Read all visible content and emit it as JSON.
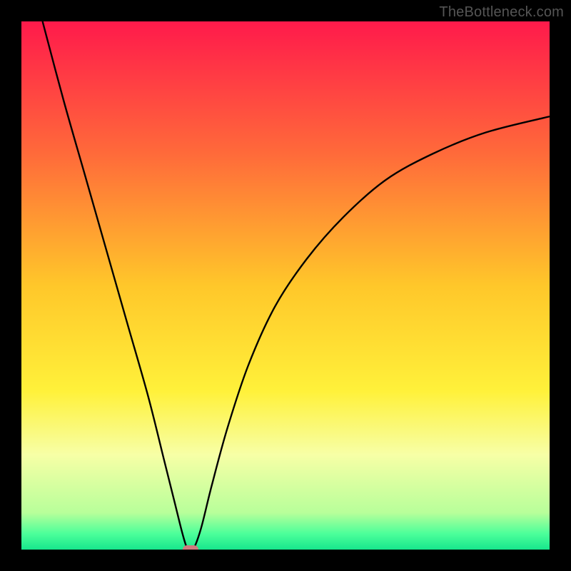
{
  "watermark": "TheBottleneck.com",
  "chart_data": {
    "type": "line",
    "title": "",
    "xlabel": "",
    "ylabel": "",
    "xlim": [
      0,
      100
    ],
    "ylim": [
      0,
      100
    ],
    "gradient_stops": [
      {
        "pos": 0.0,
        "color": "#ff1a4b"
      },
      {
        "pos": 0.25,
        "color": "#ff6a3a"
      },
      {
        "pos": 0.5,
        "color": "#ffc72a"
      },
      {
        "pos": 0.7,
        "color": "#fff13a"
      },
      {
        "pos": 0.82,
        "color": "#f7ffa6"
      },
      {
        "pos": 0.93,
        "color": "#b8ff9a"
      },
      {
        "pos": 0.97,
        "color": "#4cff9a"
      },
      {
        "pos": 1.0,
        "color": "#17e68c"
      }
    ],
    "series": [
      {
        "name": "bottleneck-curve",
        "points": [
          {
            "x": 4,
            "y": 100
          },
          {
            "x": 8,
            "y": 85
          },
          {
            "x": 12,
            "y": 71
          },
          {
            "x": 16,
            "y": 57
          },
          {
            "x": 20,
            "y": 43
          },
          {
            "x": 24,
            "y": 29
          },
          {
            "x": 27,
            "y": 17
          },
          {
            "x": 29,
            "y": 9
          },
          {
            "x": 30.5,
            "y": 3
          },
          {
            "x": 31.5,
            "y": 0
          },
          {
            "x": 32.5,
            "y": 0
          },
          {
            "x": 34,
            "y": 4
          },
          {
            "x": 36,
            "y": 12
          },
          {
            "x": 39,
            "y": 23
          },
          {
            "x": 43,
            "y": 35
          },
          {
            "x": 48,
            "y": 46
          },
          {
            "x": 54,
            "y": 55
          },
          {
            "x": 61,
            "y": 63
          },
          {
            "x": 69,
            "y": 70
          },
          {
            "x": 78,
            "y": 75
          },
          {
            "x": 88,
            "y": 79
          },
          {
            "x": 100,
            "y": 82
          }
        ]
      }
    ],
    "marker": {
      "x": 32,
      "y": 0,
      "color": "#cf7a7e"
    }
  }
}
